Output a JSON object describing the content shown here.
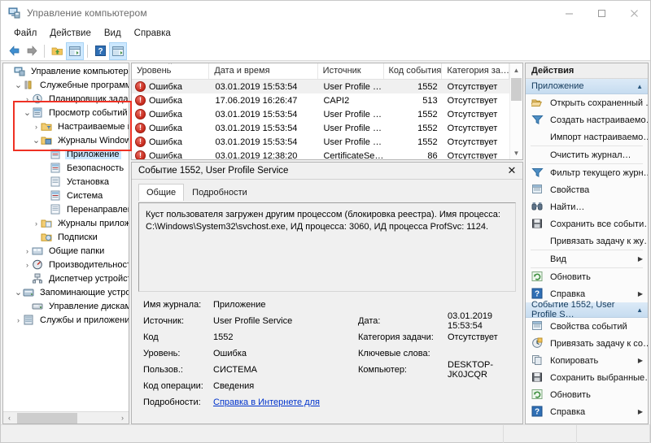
{
  "window": {
    "title": "Управление компьютером",
    "icon": "computer-management-icon",
    "minimize": "–",
    "maximize": "□",
    "close": "✕"
  },
  "menu": {
    "items": [
      {
        "label": "Файл",
        "name": "menu-file"
      },
      {
        "label": "Действие",
        "name": "menu-action"
      },
      {
        "label": "Вид",
        "name": "menu-view"
      },
      {
        "label": "Справка",
        "name": "menu-help"
      }
    ]
  },
  "toolbar": {
    "buttons": [
      {
        "name": "back-arrow-icon",
        "glyph": "back"
      },
      {
        "name": "forward-arrow-icon",
        "glyph": "forward"
      },
      {
        "name": "up-folder-icon",
        "glyph": "folder"
      },
      {
        "name": "show-hide-console-tree-icon",
        "glyph": "window",
        "selected": true
      },
      {
        "name": "help-icon",
        "glyph": "help"
      },
      {
        "name": "show-action-pane-icon",
        "glyph": "window2",
        "selected": true
      }
    ]
  },
  "sidebar": {
    "scrollbar": {
      "left_arrow": "‹",
      "right_arrow": "›"
    },
    "nodes": [
      {
        "label": "Управление компьютером (лс",
        "indent": 0,
        "chevron": "",
        "icon": "computer-icon",
        "selected": false
      },
      {
        "label": "Служебные программы",
        "indent": 1,
        "chevron": "⌄",
        "icon": "tools-icon",
        "selected": false
      },
      {
        "label": "Планировщик заданий",
        "indent": 2,
        "chevron": "›",
        "icon": "clock-icon",
        "selected": false
      },
      {
        "label": "Просмотр событий",
        "indent": 2,
        "chevron": "⌄",
        "icon": "event-viewer-icon",
        "selected": false
      },
      {
        "label": "Настраиваемые пре",
        "indent": 3,
        "chevron": "›",
        "icon": "folder-filter-icon",
        "selected": false
      },
      {
        "label": "Журналы Windows",
        "indent": 3,
        "chevron": "⌄",
        "icon": "folder-logs-icon",
        "selected": false
      },
      {
        "label": "Приложение",
        "indent": 4,
        "chevron": "",
        "icon": "log-icon",
        "selected": true
      },
      {
        "label": "Безопасность",
        "indent": 4,
        "chevron": "",
        "icon": "log-icon",
        "selected": false
      },
      {
        "label": "Установка",
        "indent": 4,
        "chevron": "",
        "icon": "log-plain-icon",
        "selected": false
      },
      {
        "label": "Система",
        "indent": 4,
        "chevron": "",
        "icon": "log-icon",
        "selected": false
      },
      {
        "label": "Перенаправлен",
        "indent": 4,
        "chevron": "",
        "icon": "log-plain-icon",
        "selected": false
      },
      {
        "label": "Журналы приложен",
        "indent": 3,
        "chevron": "›",
        "icon": "folder-app-logs-icon",
        "selected": false
      },
      {
        "label": "Подписки",
        "indent": 3,
        "chevron": "",
        "icon": "subscriptions-icon",
        "selected": false
      },
      {
        "label": "Общие папки",
        "indent": 2,
        "chevron": "›",
        "icon": "shared-folders-icon",
        "selected": false
      },
      {
        "label": "Производительность",
        "indent": 2,
        "chevron": "›",
        "icon": "performance-icon",
        "selected": false
      },
      {
        "label": "Диспетчер устройств",
        "indent": 2,
        "chevron": "",
        "icon": "device-manager-icon",
        "selected": false
      },
      {
        "label": "Запоминающие устройств",
        "indent": 1,
        "chevron": "⌄",
        "icon": "storage-icon",
        "selected": false
      },
      {
        "label": "Управление дисками",
        "indent": 2,
        "chevron": "",
        "icon": "disk-management-icon",
        "selected": false
      },
      {
        "label": "Службы и приложения",
        "indent": 1,
        "chevron": "›",
        "icon": "services-icon",
        "selected": false
      }
    ]
  },
  "event_list": {
    "sort_indicator": "^",
    "columns": [
      {
        "label": "Уровень",
        "name": "column-level",
        "width": 104
      },
      {
        "label": "Дата и время",
        "name": "column-datetime",
        "width": 146
      },
      {
        "label": "Источник",
        "name": "column-source",
        "width": 88
      },
      {
        "label": "Код события",
        "name": "column-event-id",
        "width": 78
      },
      {
        "label": "Категория за…",
        "name": "column-task-category",
        "width": 90
      }
    ],
    "rows": [
      {
        "level": "Ошибка",
        "datetime": "03.01.2019 15:53:54",
        "source": "User Profile …",
        "event_id": "1552",
        "category": "Отсутствует",
        "selected": true
      },
      {
        "level": "Ошибка",
        "datetime": "17.06.2019 16:26:47",
        "source": "CAPI2",
        "event_id": "513",
        "category": "Отсутствует",
        "selected": false
      },
      {
        "level": "Ошибка",
        "datetime": "03.01.2019 15:53:54",
        "source": "User Profile …",
        "event_id": "1552",
        "category": "Отсутствует",
        "selected": false
      },
      {
        "level": "Ошибка",
        "datetime": "03.01.2019 15:53:54",
        "source": "User Profile …",
        "event_id": "1552",
        "category": "Отсутствует",
        "selected": false
      },
      {
        "level": "Ошибка",
        "datetime": "03.01.2019 15:53:54",
        "source": "User Profile …",
        "event_id": "1552",
        "category": "Отсутствует",
        "selected": false
      },
      {
        "level": "Ошибка",
        "datetime": "03.01.2019 12:38:20",
        "source": "CertificateSe…",
        "event_id": "86",
        "category": "Отсутствует",
        "selected": false
      }
    ],
    "scrollbar": {
      "up": "▲",
      "down": "▼"
    }
  },
  "detail": {
    "title": "Событие 1552, User Profile Service",
    "close": "✕",
    "tabs": [
      {
        "label": "Общие",
        "name": "tab-general",
        "active": true
      },
      {
        "label": "Подробности",
        "name": "tab-details",
        "active": false
      }
    ],
    "message": "Куст пользователя загружен другим процессом (блокировка реестра). Имя процесса: C:\\Windows\\System32\\svchost.exe, ИД процесса: 3060, ИД процесса ProfSvc: 1124.",
    "fields": {
      "log_name_label": "Имя журнала:",
      "log_name_value": "Приложение",
      "source_label": "Источник:",
      "source_value": "User Profile Service",
      "date_label": "Дата:",
      "date_value": "03.01.2019 15:53:54",
      "code_label": "Код",
      "code_value": "1552",
      "task_category_label": "Категория задачи:",
      "task_category_value": "Отсутствует",
      "level_label": "Уровень:",
      "level_value": "Ошибка",
      "keywords_label": "Ключевые слова:",
      "keywords_value": "",
      "user_label": "Пользов.:",
      "user_value": "СИСТЕМА",
      "computer_label": "Компьютер:",
      "computer_value": "DESKTOP-JK0JCQR",
      "opcode_label": "Код операции:",
      "opcode_value": "Сведения",
      "more_info_label": "Подробности:",
      "more_info_link": "Справка в Интернете для"
    }
  },
  "actions": {
    "header": "Действия",
    "group1": {
      "title": "Приложение",
      "caret": "▲"
    },
    "group1_items": [
      {
        "label": "Открыть сохраненный …",
        "name": "action-open-saved-log",
        "icon": "open-folder-icon",
        "submenu": false
      },
      {
        "label": "Создать настраиваемо…",
        "name": "action-create-custom-view",
        "icon": "filter-icon",
        "submenu": false
      },
      {
        "label": "Импорт настраиваемо…",
        "name": "action-import-custom-view",
        "icon": "none",
        "submenu": false
      },
      {
        "label": "Очистить журнал…",
        "name": "action-clear-log",
        "icon": "none",
        "submenu": false
      },
      {
        "label": "Фильтр текущего журн…",
        "name": "action-filter-current-log",
        "icon": "filter-icon",
        "submenu": false
      },
      {
        "label": "Свойства",
        "name": "action-properties",
        "icon": "properties-icon",
        "submenu": false
      },
      {
        "label": "Найти…",
        "name": "action-find",
        "icon": "binoculars-icon",
        "submenu": false
      },
      {
        "label": "Сохранить все событи…",
        "name": "action-save-all-events",
        "icon": "save-icon",
        "submenu": false
      },
      {
        "label": "Привязать задачу к жу…",
        "name": "action-attach-task-to-log",
        "icon": "none",
        "submenu": false
      },
      {
        "label": "Вид",
        "name": "action-view",
        "icon": "none",
        "submenu": true,
        "arrow": "▶"
      },
      {
        "label": "Обновить",
        "name": "action-refresh",
        "icon": "refresh-icon",
        "submenu": false
      },
      {
        "label": "Справка",
        "name": "action-help",
        "icon": "help-icon",
        "submenu": true,
        "arrow": "▶"
      }
    ],
    "group2": {
      "title": "Событие 1552, User Profile S…",
      "caret": "▲"
    },
    "group2_items": [
      {
        "label": "Свойства событий",
        "name": "action-event-properties",
        "icon": "properties-icon",
        "submenu": false
      },
      {
        "label": "Привязать задачу к со…",
        "name": "action-attach-task-to-event",
        "icon": "attach-task-icon",
        "submenu": false
      },
      {
        "label": "Копировать",
        "name": "action-copy",
        "icon": "copy-icon",
        "submenu": true,
        "arrow": "▶"
      },
      {
        "label": "Сохранить выбранные…",
        "name": "action-save-selected-events",
        "icon": "save-icon",
        "submenu": false
      },
      {
        "label": "Обновить",
        "name": "action-refresh-2",
        "icon": "refresh-icon",
        "submenu": false
      },
      {
        "label": "Справка",
        "name": "action-help-2",
        "icon": "help-icon",
        "submenu": true,
        "arrow": "▶"
      }
    ]
  },
  "colors": {
    "accent_selection": "#cce8ff",
    "highlight_box": "#ef3124",
    "error_red": "#c62a1c",
    "link_blue": "#0033cc",
    "group_header_blue": "#c6dcf0"
  }
}
